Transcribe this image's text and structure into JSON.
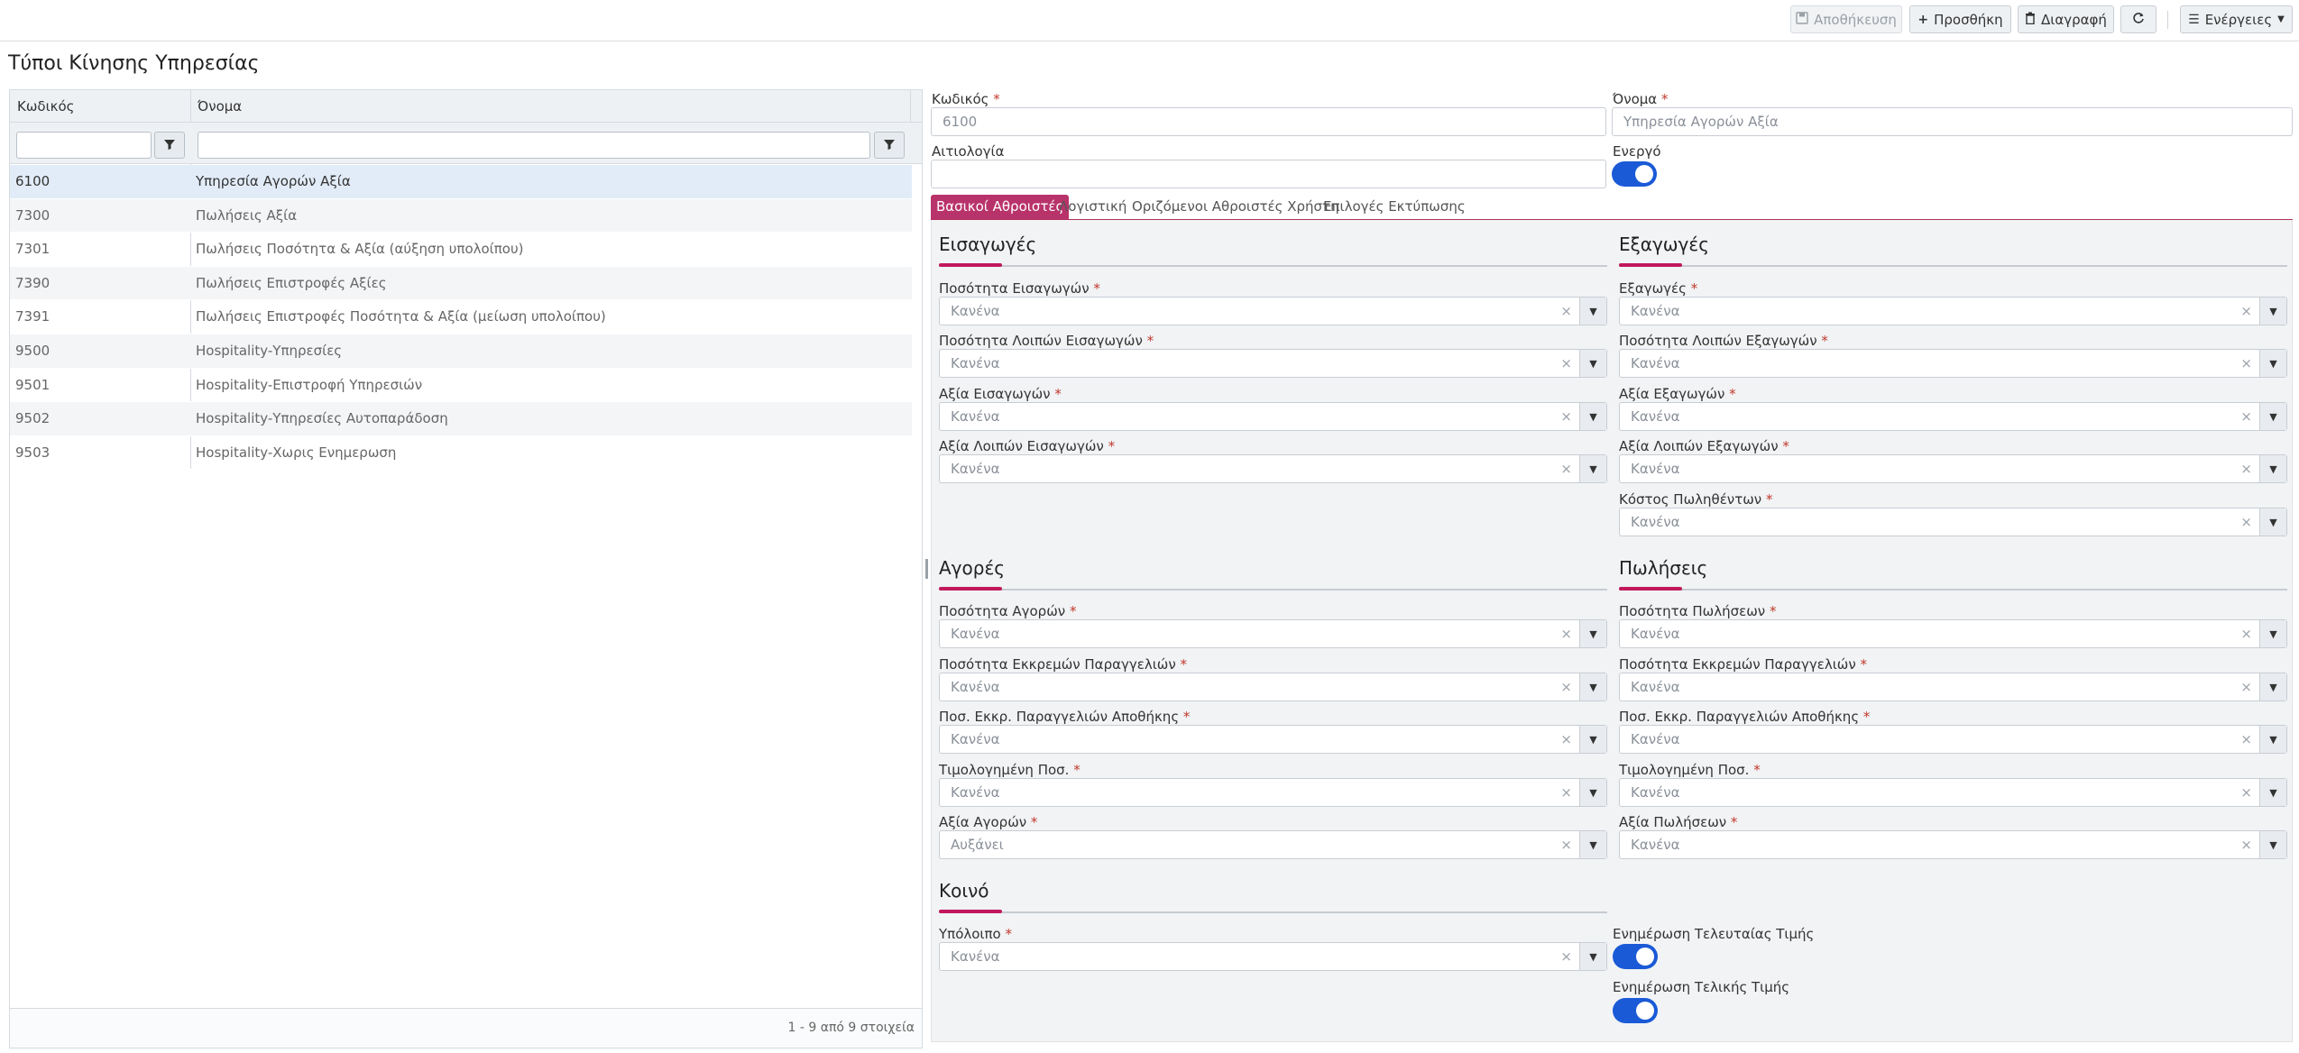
{
  "toolbar": {
    "save_label": "Αποθήκευση",
    "add_label": "Προσθήκη",
    "delete_label": "Διαγραφή",
    "actions_label": "Ενέργειες"
  },
  "page": {
    "title": "Τύποι Κίνησης Υπηρεσίας"
  },
  "grid": {
    "columns": [
      "Κωδικός",
      "Όνομα"
    ],
    "rows": [
      {
        "code": "6100",
        "name": "Υπηρεσία Αγορών Αξία"
      },
      {
        "code": "7300",
        "name": "Πωλήσεις Αξία"
      },
      {
        "code": "7301",
        "name": "Πωλήσεις Ποσότητα & Αξία (αύξηση υπολοίπου)"
      },
      {
        "code": "7390",
        "name": "Πωλήσεις Επιστροφές Αξίες"
      },
      {
        "code": "7391",
        "name": "Πωλήσεις Επιστροφές Ποσότητα & Αξία (μείωση υπολοίπου)"
      },
      {
        "code": "9500",
        "name": "Hospitality-Υπηρεσίες"
      },
      {
        "code": "9501",
        "name": "Hospitality-Επιστροφή Υπηρεσιών"
      },
      {
        "code": "9502",
        "name": "Hospitality-Υπηρεσίες Αυτοπαράδοση"
      },
      {
        "code": "9503",
        "name": "Hospitality-Χωρις Ενημερωση"
      }
    ],
    "footer": "1 - 9 από 9 στοιχεία"
  },
  "form": {
    "code_label": "Κωδικός",
    "code_value": "6100",
    "name_label": "Όνομα",
    "name_value": "Υπηρεσία Αγορών Αξία",
    "reason_label": "Αιτιολογία",
    "reason_value": "",
    "active_label": "Ενεργό"
  },
  "tabs": [
    "Βασικοί Αθροιστές",
    "Λογιστική",
    "Οριζόμενοι Αθροιστές Χρήστη",
    "Επιλογές Εκτύπωσης"
  ],
  "sections": {
    "imports": {
      "title": "Εισαγωγές",
      "fields": [
        {
          "label": "Ποσότητα Εισαγωγών",
          "value": "Κανένα"
        },
        {
          "label": "Ποσότητα Λοιπών Εισαγωγών",
          "value": "Κανένα"
        },
        {
          "label": "Αξία Εισαγωγών",
          "value": "Κανένα"
        },
        {
          "label": "Αξία Λοιπών Εισαγωγών",
          "value": "Κανένα"
        }
      ]
    },
    "exports": {
      "title": "Εξαγωγές",
      "fields": [
        {
          "label": "Εξαγωγές",
          "value": "Κανένα"
        },
        {
          "label": "Ποσότητα Λοιπών Εξαγωγών",
          "value": "Κανένα"
        },
        {
          "label": "Αξία Εξαγωγών",
          "value": "Κανένα"
        },
        {
          "label": "Αξία Λοιπών Εξαγωγών",
          "value": "Κανένα"
        },
        {
          "label": "Κόστος Πωληθέντων",
          "value": "Κανένα"
        }
      ]
    },
    "purchases": {
      "title": "Αγορές",
      "fields": [
        {
          "label": "Ποσότητα Αγορών",
          "value": "Κανένα"
        },
        {
          "label": "Ποσότητα Εκκρεμών Παραγγελιών",
          "value": "Κανένα"
        },
        {
          "label": "Ποσ. Εκκρ. Παραγγελιών Αποθήκης",
          "value": "Κανένα"
        },
        {
          "label": "Τιμολογημένη Ποσ.",
          "value": "Κανένα"
        },
        {
          "label": "Αξία Αγορών",
          "value": "Αυξάνει"
        }
      ]
    },
    "sales": {
      "title": "Πωλήσεις",
      "fields": [
        {
          "label": "Ποσότητα Πωλήσεων",
          "value": "Κανένα"
        },
        {
          "label": "Ποσότητα Εκκρεμών Παραγγελιών",
          "value": "Κανένα"
        },
        {
          "label": "Ποσ. Εκκρ. Παραγγελιών Αποθήκης",
          "value": "Κανένα"
        },
        {
          "label": "Τιμολογημένη Ποσ.",
          "value": "Κανένα"
        },
        {
          "label": "Αξία Πωλήσεων",
          "value": "Κανένα"
        }
      ]
    },
    "common": {
      "title": "Κοινό",
      "balance_label": "Υπόλοιπο",
      "balance_value": "Κανένα",
      "update_last_price_label": "Ενημέρωση Τελευταίας Τιμής",
      "update_final_price_label": "Ενημέρωση Τελικής Τιμής"
    }
  },
  "symbols": {
    "required": "*",
    "clear": "×",
    "arrow": "▼"
  }
}
